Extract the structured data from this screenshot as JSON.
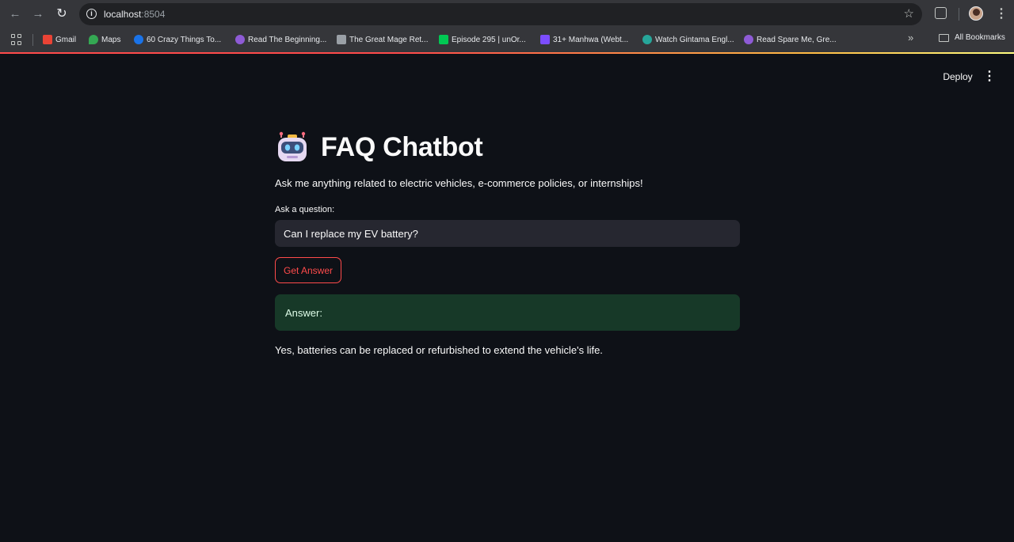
{
  "browser": {
    "url_host": "localhost",
    "url_port": ":8504",
    "bookmarks": [
      {
        "label": "Gmail",
        "color": "#ea4335"
      },
      {
        "label": "Maps",
        "color": "#34a853"
      },
      {
        "label": "60 Crazy Things To...",
        "color": "#1a73e8"
      },
      {
        "label": "Read The Beginning...",
        "color": "#8e5bd6"
      },
      {
        "label": "The Great Mage Ret...",
        "color": "#9aa0a6"
      },
      {
        "label": "Episode 295 | unOr...",
        "color": "#00c853"
      },
      {
        "label": "31+ Manhwa (Webt...",
        "color": "#7c4dff"
      },
      {
        "label": "Watch Gintama Engl...",
        "color": "#26a69a"
      },
      {
        "label": "Read Spare Me, Gre...",
        "color": "#8e5bd6"
      }
    ],
    "all_bookmarks_label": "All Bookmarks"
  },
  "app": {
    "deploy_label": "Deploy",
    "title": "FAQ Chatbot",
    "subtitle": "Ask me anything related to electric vehicles, e-commerce policies, or internships!",
    "question_label": "Ask a question:",
    "question_value": "Can I replace my EV battery?",
    "button_label": "Get Answer",
    "answer_label": "Answer:",
    "answer_text": "Yes, batteries can be replaced or refurbished to extend the vehicle's life.",
    "colors": {
      "background": "#0e1117",
      "accent": "#ff4b4b",
      "success_bg": "#173928"
    }
  }
}
